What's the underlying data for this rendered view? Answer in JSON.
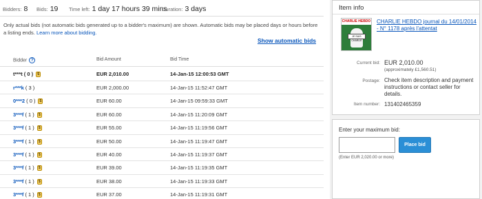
{
  "summary": {
    "bidders_label": "Bidders:",
    "bidders_value": "8",
    "bids_label": "Bids:",
    "bids_value": "19",
    "time_left_label": "Time left:",
    "time_left_value": "1 day 17 hours 39 mins",
    "duration_label": "Duration:",
    "duration_value": "3 days"
  },
  "notice": {
    "text": "Only actual bids (not automatic bids generated up to a bidder's maximum) are shown. Automatic bids may be placed days or hours before a listing ends.",
    "link_label": "Learn more about bidding."
  },
  "show_automatic_bids_label": "Show automatic bids",
  "table": {
    "col_bidder": "Bidder",
    "col_amount": "Bid Amount",
    "col_time": "Bid Time",
    "rows": [
      {
        "bidder": "t***t",
        "feedback": "( 0 )",
        "auto": true,
        "amount": "EUR 2,010.00",
        "time": "14-Jan-15 12:00:53 GMT"
      },
      {
        "bidder": "r***k",
        "feedback": "( 3 )",
        "auto": false,
        "amount": "EUR 2,000.00",
        "time": "14-Jan-15 11:52:47 GMT"
      },
      {
        "bidder": "0***2",
        "feedback": "( 0 )",
        "auto": true,
        "amount": "EUR 60.00",
        "time": "14-Jan-15 09:59:33 GMT"
      },
      {
        "bidder": "3***f",
        "feedback": "( 1 )",
        "auto": true,
        "amount": "EUR 60.00",
        "time": "14-Jan-15 11:20:09 GMT"
      },
      {
        "bidder": "3***f",
        "feedback": "( 1 )",
        "auto": true,
        "amount": "EUR 55.00",
        "time": "14-Jan-15 11:19:56 GMT"
      },
      {
        "bidder": "3***f",
        "feedback": "( 1 )",
        "auto": true,
        "amount": "EUR 50.00",
        "time": "14-Jan-15 11:19:47 GMT"
      },
      {
        "bidder": "3***f",
        "feedback": "( 1 )",
        "auto": true,
        "amount": "EUR 40.00",
        "time": "14-Jan-15 11:19:37 GMT"
      },
      {
        "bidder": "3***f",
        "feedback": "( 1 )",
        "auto": true,
        "amount": "EUR 39.00",
        "time": "14-Jan-15 11:19:35 GMT"
      },
      {
        "bidder": "3***f",
        "feedback": "( 1 )",
        "auto": true,
        "amount": "EUR 38.00",
        "time": "14-Jan-15 11:19:33 GMT"
      },
      {
        "bidder": "3***f",
        "feedback": "( 1 )",
        "auto": true,
        "amount": "EUR 37.00",
        "time": "14-Jan-15 11:19:31 GMT"
      }
    ]
  },
  "item_info": {
    "title": "Item info",
    "item_title": "CHARLIE HEBDO journal du 14/01/2014 - N° 1178 après l'attentat",
    "thumb_masthead": "CHARLIE HEBDO",
    "thumb_sign": "JE SUIS CHARLIE",
    "current_bid_label": "Current bid:",
    "current_bid_value": "EUR 2,010.00",
    "current_bid_approx": "(approximately £1,560.51)",
    "postage_label": "Postage:",
    "postage_value": "Check item description and payment instructions or contact seller for details.",
    "item_number_label": "Item number:",
    "item_number_value": "131402465359"
  },
  "bid_form": {
    "prompt": "Enter your maximum bid:",
    "input_value": "",
    "button_label": "Place bid",
    "hint": "(Enter EUR 2,020.00 or more)"
  },
  "colors": {
    "link": "#0654ba",
    "button": "#2b8fd6",
    "sidebar_bg": "#f2f2f2"
  }
}
